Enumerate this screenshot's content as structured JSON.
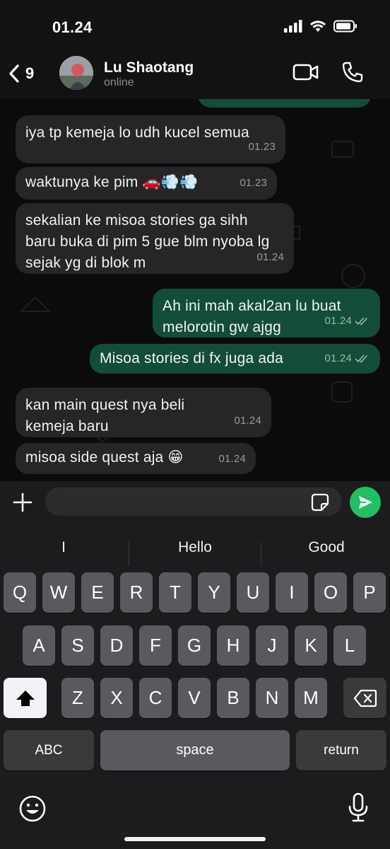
{
  "status_bar": {
    "time": "01.24"
  },
  "header": {
    "back_count": "9",
    "contact_name": "Lu Shaotang",
    "contact_status": "online"
  },
  "messages": [
    {
      "dir": "in",
      "text": "iya tp kemeja lo udh kucel semua",
      "time": "01.23"
    },
    {
      "dir": "in",
      "text": "waktunya ke pim 🚗💨💨",
      "time": "01.23"
    },
    {
      "dir": "in",
      "text": "sekalian ke misoa stories ga sihh baru buka di pim 5 gue blm nyoba lg sejak yg di blok m",
      "time": "01.24"
    },
    {
      "dir": "out",
      "text": "Ah ini mah akal2an lu buat melorotin gw ajgg",
      "time": "01.24",
      "status": "read"
    },
    {
      "dir": "out",
      "text": "Misoa stories di fx juga ada",
      "time": "01.24",
      "status": "read"
    },
    {
      "dir": "in",
      "text": "kan main quest nya beli kemeja baru",
      "time": "01.24"
    },
    {
      "dir": "in",
      "text": "misoa side quest aja 😁",
      "time": "01.24"
    }
  ],
  "input": {
    "value": "",
    "placeholder": ""
  },
  "keyboard": {
    "suggestions": [
      "I",
      "Hello",
      "Good"
    ],
    "row1": [
      "Q",
      "W",
      "E",
      "R",
      "T",
      "Y",
      "U",
      "I",
      "O",
      "P"
    ],
    "row2": [
      "A",
      "S",
      "D",
      "F",
      "G",
      "H",
      "J",
      "K",
      "L"
    ],
    "row3": [
      "Z",
      "X",
      "C",
      "V",
      "B",
      "N",
      "M"
    ],
    "abc_label": "ABC",
    "space_label": "space",
    "return_label": "return"
  },
  "colors": {
    "incoming_bubble": "#262628",
    "outgoing_bubble": "#134d37",
    "send_button": "#21c063"
  },
  "icons": {
    "back": "chevron-left-icon",
    "video": "video-camera-icon",
    "call": "phone-icon",
    "plus": "plus-icon",
    "sticker": "sticker-icon",
    "send": "send-icon",
    "shift": "shift-arrow-icon",
    "backspace": "backspace-icon",
    "emoji": "emoji-icon",
    "mic": "microphone-icon"
  }
}
